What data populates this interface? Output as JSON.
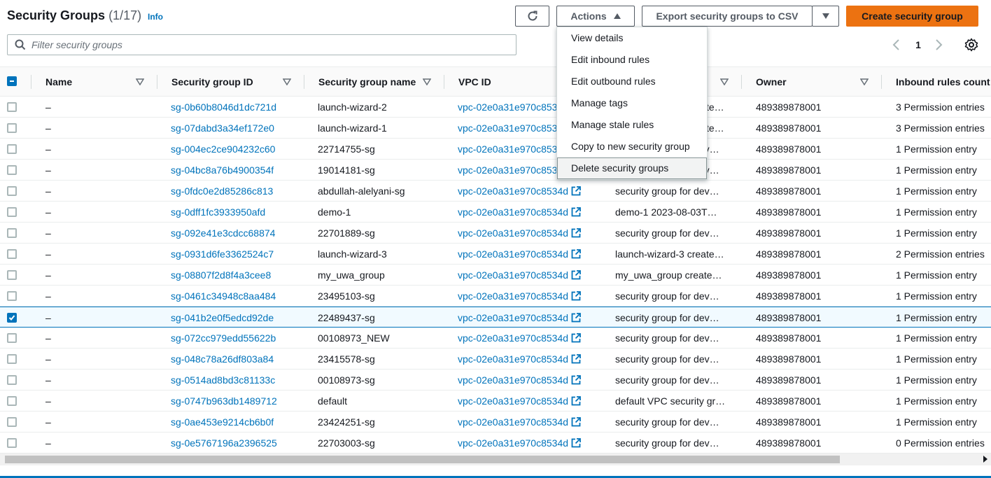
{
  "header": {
    "title": "Security Groups",
    "count": "(1/17)",
    "info": "Info",
    "actions_label": "Actions",
    "export_label": "Export security groups to CSV",
    "create_label": "Create security group"
  },
  "filter": {
    "placeholder": "Filter security groups"
  },
  "pagination": {
    "page": "1"
  },
  "columns": {
    "name": "Name",
    "sg_id": "Security group ID",
    "sg_name": "Security group name",
    "vpc_id": "VPC ID",
    "owner": "Owner",
    "inbound": "Inbound rules count"
  },
  "actions_menu": [
    "View details",
    "Edit inbound rules",
    "Edit outbound rules",
    "Manage tags",
    "Manage stale rules",
    "Copy to new security group",
    "Delete security groups"
  ],
  "rows": [
    {
      "name": "–",
      "id": "sg-0b60b8046d1dc721d",
      "sgname": "launch-wizard-2",
      "vpc": "vpc-02e0a31e970c8534d",
      "desc": "launch-wizard-2 create…",
      "owner": "489389878001",
      "inbound": "3 Permission entries",
      "checked": false
    },
    {
      "name": "–",
      "id": "sg-07dabd3a34ef172e0",
      "sgname": "launch-wizard-1",
      "vpc": "vpc-02e0a31e970c8534d",
      "desc": "launch-wizard-1 create…",
      "owner": "489389878001",
      "inbound": "3 Permission entries",
      "checked": false
    },
    {
      "name": "–",
      "id": "sg-004ec2ce904232c60",
      "sgname": "22714755-sg",
      "vpc": "vpc-02e0a31e970c8534d",
      "desc": "security group for dev…",
      "owner": "489389878001",
      "inbound": "1 Permission entry",
      "checked": false
    },
    {
      "name": "–",
      "id": "sg-04bc8a76b4900354f",
      "sgname": "19014181-sg",
      "vpc": "vpc-02e0a31e970c8534d",
      "desc": "security group for dev…",
      "owner": "489389878001",
      "inbound": "1 Permission entry",
      "checked": false
    },
    {
      "name": "–",
      "id": "sg-0fdc0e2d85286c813",
      "sgname": "abdullah-alelyani-sg",
      "vpc": "vpc-02e0a31e970c8534d",
      "desc": "security group for dev…",
      "owner": "489389878001",
      "inbound": "1 Permission entry",
      "checked": false
    },
    {
      "name": "–",
      "id": "sg-0dff1fc3933950afd",
      "sgname": "demo-1",
      "vpc": "vpc-02e0a31e970c8534d",
      "desc": "demo-1 2023-08-03T…",
      "owner": "489389878001",
      "inbound": "1 Permission entry",
      "checked": false
    },
    {
      "name": "–",
      "id": "sg-092e41e3cdcc68874",
      "sgname": "22701889-sg",
      "vpc": "vpc-02e0a31e970c8534d",
      "desc": "security group for dev…",
      "owner": "489389878001",
      "inbound": "1 Permission entry",
      "checked": false
    },
    {
      "name": "–",
      "id": "sg-0931d6fe3362524c7",
      "sgname": "launch-wizard-3",
      "vpc": "vpc-02e0a31e970c8534d",
      "desc": "launch-wizard-3 create…",
      "owner": "489389878001",
      "inbound": "2 Permission entries",
      "checked": false
    },
    {
      "name": "–",
      "id": "sg-08807f2d8f4a3cee8",
      "sgname": "my_uwa_group",
      "vpc": "vpc-02e0a31e970c8534d",
      "desc": "my_uwa_group create…",
      "owner": "489389878001",
      "inbound": "1 Permission entry",
      "checked": false
    },
    {
      "name": "–",
      "id": "sg-0461c34948c8aa484",
      "sgname": "23495103-sg",
      "vpc": "vpc-02e0a31e970c8534d",
      "desc": "security group for dev…",
      "owner": "489389878001",
      "inbound": "1 Permission entry",
      "checked": false
    },
    {
      "name": "–",
      "id": "sg-041b2e0f5edcd92de",
      "sgname": "22489437-sg",
      "vpc": "vpc-02e0a31e970c8534d",
      "desc": "security group for dev…",
      "owner": "489389878001",
      "inbound": "1 Permission entry",
      "checked": true
    },
    {
      "name": "–",
      "id": "sg-072cc979edd55622b",
      "sgname": "00108973_NEW",
      "vpc": "vpc-02e0a31e970c8534d",
      "desc": "security group for dev…",
      "owner": "489389878001",
      "inbound": "1 Permission entry",
      "checked": false
    },
    {
      "name": "–",
      "id": "sg-048c78a26df803a84",
      "sgname": "23415578-sg",
      "vpc": "vpc-02e0a31e970c8534d",
      "desc": "security group for dev…",
      "owner": "489389878001",
      "inbound": "1 Permission entry",
      "checked": false
    },
    {
      "name": "–",
      "id": "sg-0514ad8bd3c81133c",
      "sgname": "00108973-sg",
      "vpc": "vpc-02e0a31e970c8534d",
      "desc": "security group for dev…",
      "owner": "489389878001",
      "inbound": "1 Permission entry",
      "checked": false
    },
    {
      "name": "–",
      "id": "sg-0747b963db1489712",
      "sgname": "default",
      "vpc": "vpc-02e0a31e970c8534d",
      "desc": "default VPC security gr…",
      "owner": "489389878001",
      "inbound": "1 Permission entry",
      "checked": false
    },
    {
      "name": "–",
      "id": "sg-0ae453e9214cb6b0f",
      "sgname": "23424251-sg",
      "vpc": "vpc-02e0a31e970c8534d",
      "desc": "security group for dev…",
      "owner": "489389878001",
      "inbound": "1 Permission entry",
      "checked": false
    },
    {
      "name": "–",
      "id": "sg-0e5767196a2396525",
      "sgname": "22703003-sg",
      "vpc": "vpc-02e0a31e970c8534d",
      "desc": "security group for dev…",
      "owner": "489389878001",
      "inbound": "0 Permission entries",
      "checked": false
    }
  ],
  "colors": {
    "link": "#0073bb",
    "primary": "#ec7211",
    "selected_bg": "#f1faff"
  }
}
